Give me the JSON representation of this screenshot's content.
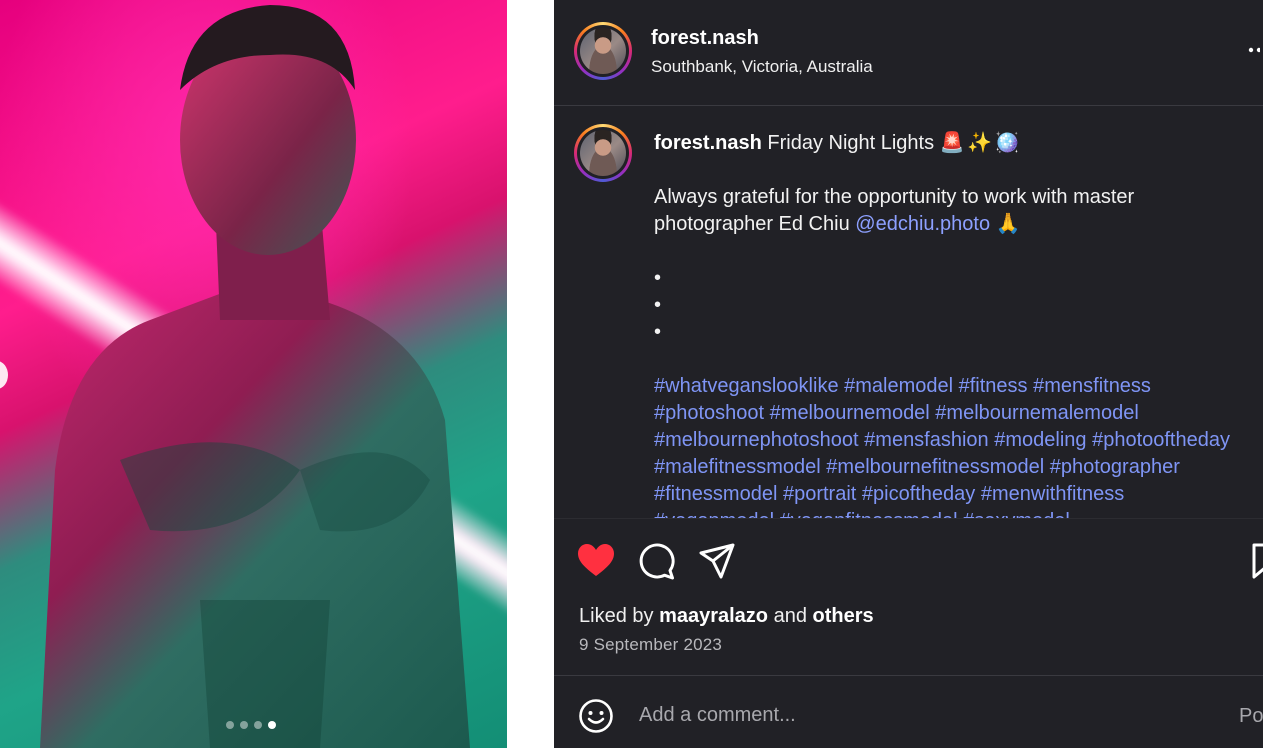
{
  "post": {
    "username": "forest.nash",
    "location": "Southbank, Victoria, Australia",
    "more_label": ":"
  },
  "caption": {
    "username": "forest.nash",
    "title": "Friday Night Lights",
    "title_emojis": [
      "🚨",
      "✨",
      "🪩"
    ],
    "line1": "Always grateful for the opportunity to work with master photographer Ed Chiu",
    "mention": "@edchiu.photo",
    "mention_emoji": "🙏",
    "dots": [
      "•",
      "•",
      "•"
    ],
    "hashtags": "#whatveganslooklike #malemodel #fitness #mensfitness #photoshoot #melbournemodel #melbournemalemodel #melbournephotoshoot #mensfashion #modeling #photooftheday #malefitnessmodel #melbournefitnessmodel #photographer #fitnessmodel #portrait #picoftheday #menwithfitness #veganmodel #veganfitnessmodel #sexymodel"
  },
  "carousel": {
    "dot_count": 4,
    "active_index": 3
  },
  "engagement": {
    "liked_prefix": "Liked by",
    "liked_user": "maayralazo",
    "liked_and": "and",
    "liked_others": "others",
    "date": "9 September 2023",
    "liked": true
  },
  "comment": {
    "placeholder": "Add a comment...",
    "post_label": "Post"
  },
  "colors": {
    "panel_bg": "#212126",
    "like_red": "#ff3040",
    "hashtag_blue": "#7f95f5",
    "mention_blue": "#8da0ff"
  },
  "icons": [
    "heart-icon",
    "comment-icon",
    "share-icon",
    "bookmark-icon",
    "emoji-icon",
    "more-icon"
  ]
}
